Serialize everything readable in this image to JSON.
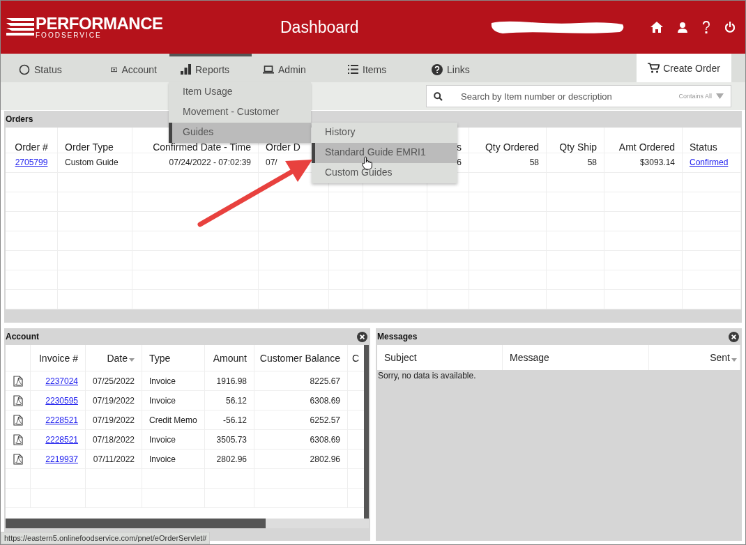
{
  "header": {
    "logo_name": "PERFORMANCE",
    "logo_tagline": "FOODSERVICE",
    "title": "Dashboard"
  },
  "nav": {
    "tabs": [
      {
        "label": "Status",
        "kind": "status",
        "selected": false
      },
      {
        "label": "Account",
        "kind": "account",
        "selected": false
      },
      {
        "label": "Reports",
        "kind": "reports",
        "selected": true
      },
      {
        "label": "Admin",
        "kind": "admin",
        "selected": false
      },
      {
        "label": "Items",
        "kind": "items",
        "selected": false
      },
      {
        "label": "Links",
        "kind": "links",
        "selected": false
      }
    ],
    "create_order": "Create Order"
  },
  "search": {
    "placeholder": "Search by Item number or description",
    "mode": "Contains All"
  },
  "reports_menu": {
    "items": [
      {
        "label": "Item Usage",
        "selected": false
      },
      {
        "label": "Movement - Customer",
        "selected": false
      },
      {
        "label": "Guides",
        "selected": true
      }
    ]
  },
  "guides_submenu": {
    "items": [
      {
        "label": "History",
        "selected": false
      },
      {
        "label": "Standard Guide EMRI1",
        "selected": true
      },
      {
        "label": "Custom Guides",
        "selected": false
      }
    ]
  },
  "orders": {
    "title": "Orders",
    "columns": [
      {
        "header": "Order #",
        "link": true
      },
      {
        "header": "Order Type",
        "link": false
      },
      {
        "header": "Confirmed Date - Time",
        "link": false
      },
      {
        "header": "Order D",
        "link": false
      },
      {
        "header": "s",
        "link": false
      },
      {
        "header": "Qty Ordered",
        "link": false
      },
      {
        "header": "Qty Ship",
        "link": false
      },
      {
        "header": "Amt Ordered",
        "link": false
      },
      {
        "header": "Status",
        "link": true
      }
    ],
    "rows": [
      {
        "cells": [
          "2705799",
          "Custom Guide",
          "07/24/2022 - 07:02:39",
          "07/",
          "6",
          "58",
          "58",
          "$3093.14",
          "Confirmed"
        ]
      }
    ]
  },
  "account": {
    "title": "Account",
    "columns": [
      {
        "header": "Invoice #",
        "sorted": false
      },
      {
        "header": "Date",
        "sorted": true
      },
      {
        "header": "Type",
        "sorted": false
      },
      {
        "header": "Amount",
        "sorted": false
      },
      {
        "header": "Customer Balance",
        "sorted": false
      },
      {
        "header": "C",
        "sorted": false
      }
    ],
    "rows": [
      {
        "cells": [
          "2237024",
          "07/25/2022",
          "Invoice",
          "1916.98",
          "8225.67"
        ]
      },
      {
        "cells": [
          "2230595",
          "07/19/2022",
          "Invoice",
          "56.12",
          "6308.69"
        ]
      },
      {
        "cells": [
          "2228521",
          "07/19/2022",
          "Credit Memo",
          "-56.12",
          "6252.57"
        ]
      },
      {
        "cells": [
          "2228521",
          "07/18/2022",
          "Invoice",
          "3505.73",
          "6308.69"
        ]
      },
      {
        "cells": [
          "2219937",
          "07/11/2022",
          "Invoice",
          "2802.96",
          "2802.96"
        ]
      }
    ]
  },
  "messages": {
    "title": "Messages",
    "columns": [
      {
        "header": "Subject",
        "sorted": false
      },
      {
        "header": "Message",
        "sorted": false
      },
      {
        "header": "Sent",
        "sorted": true
      }
    ],
    "empty_text": "Sorry, no data is available."
  },
  "status_url": "https://eastern5.onlinefoodservice.com/pnet/eOrderServlet#"
}
